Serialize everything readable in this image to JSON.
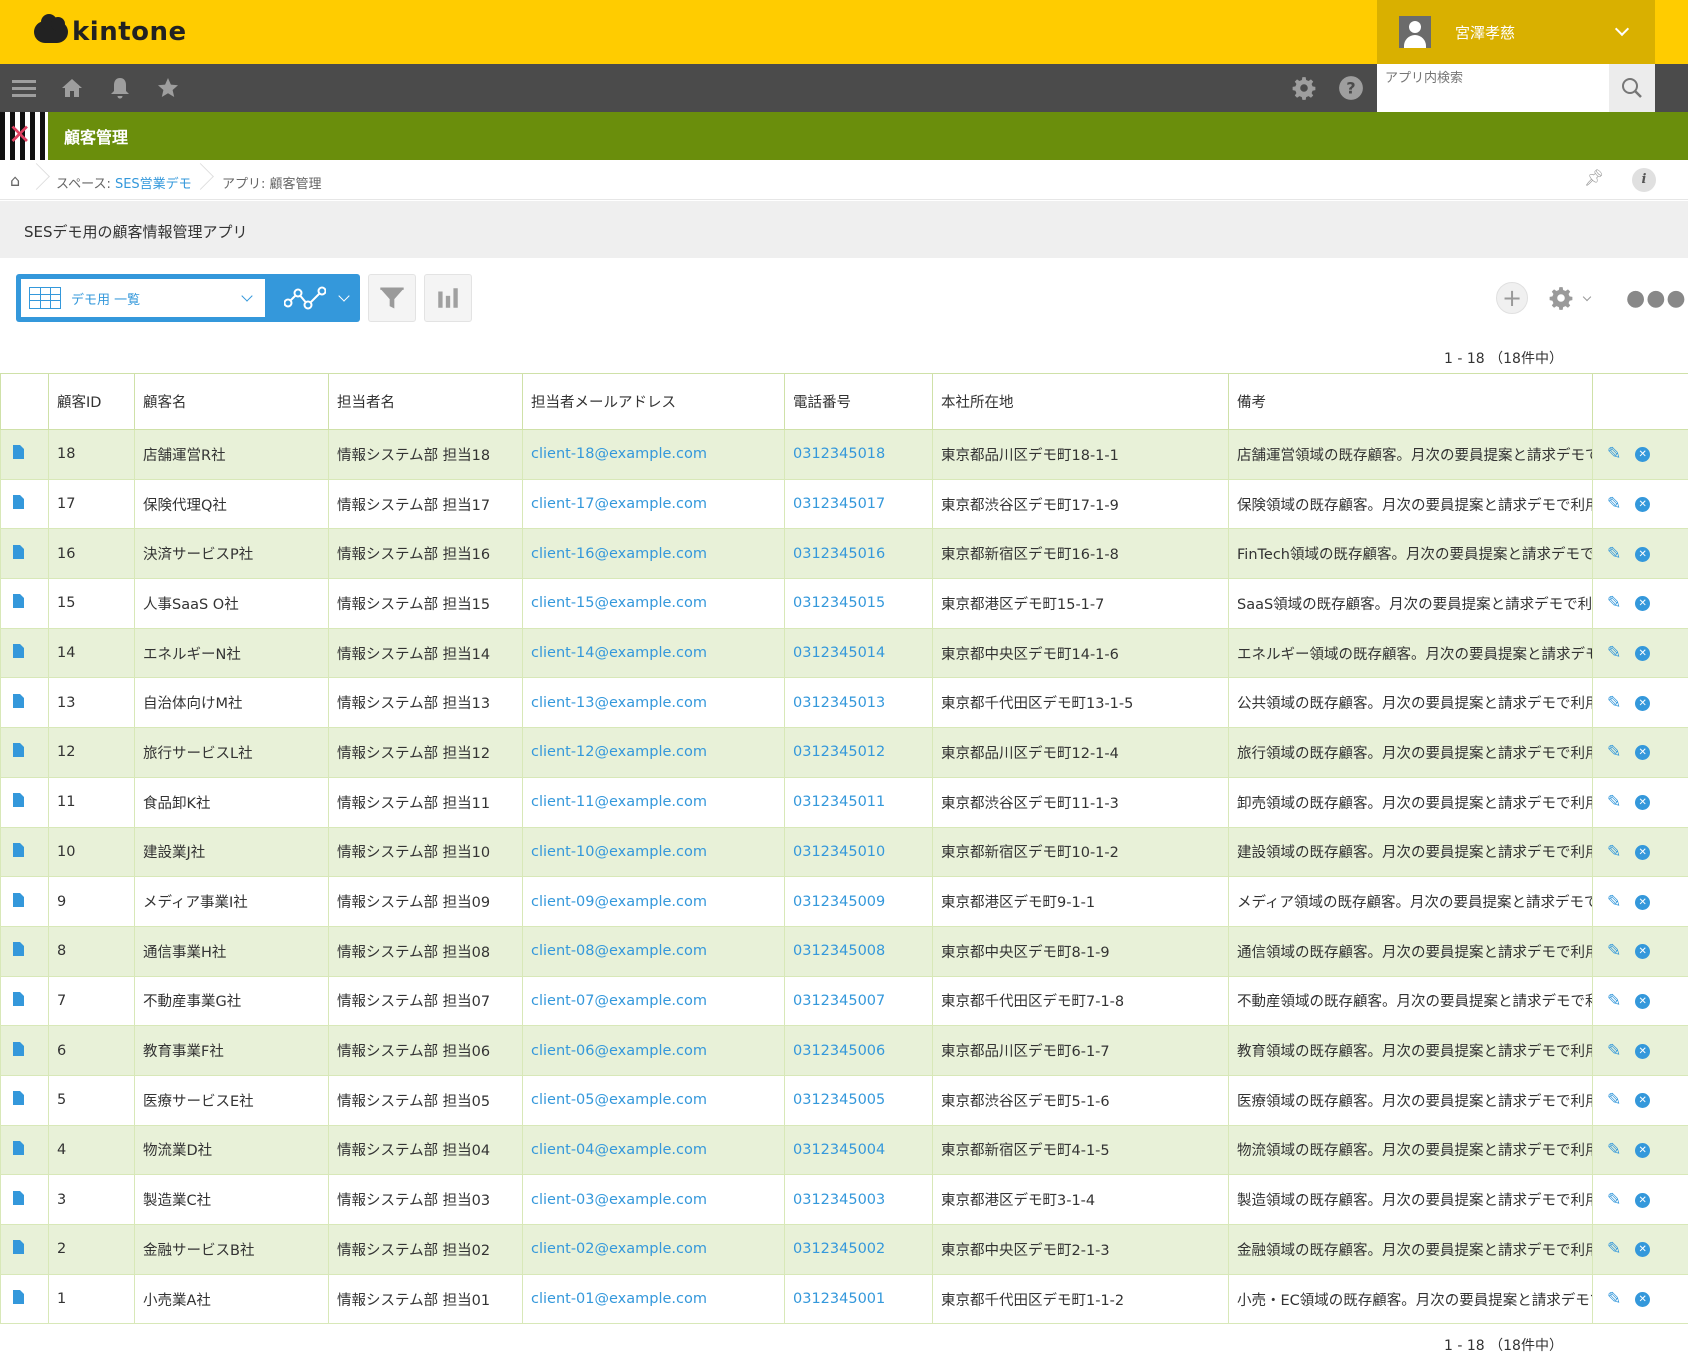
{
  "brand": {
    "logo_text": "kintone"
  },
  "user": {
    "name": "宮澤孝慈"
  },
  "search": {
    "placeholder": "アプリ内検索"
  },
  "app": {
    "name": "顧客管理"
  },
  "breadcrumb": {
    "space_prefix": "スペース: ",
    "space_name": "SES営業デモ",
    "app_label": "アプリ: 顧客管理"
  },
  "description": "SESデモ用の顧客情報管理アプリ",
  "view": {
    "name": "デモ用 一覧"
  },
  "count": {
    "top": "1 - 18 （18件中）",
    "bottom": "1 - 18 （18件中）"
  },
  "columns": [
    "顧客ID",
    "顧客名",
    "担当者名",
    "担当者メールアドレス",
    "電話番号",
    "本社所在地",
    "備考"
  ],
  "rows": [
    {
      "id": "18",
      "name": "店舗運営R社",
      "contact": "情報システム部 担当18",
      "email": "client-18@example.com",
      "phone": "0312345018",
      "address": "東京都品川区デモ町18-1-1",
      "note": "店舗運営領域の既存顧客。月次の要員提案と請求デモで"
    },
    {
      "id": "17",
      "name": "保険代理Q社",
      "contact": "情報システム部 担当17",
      "email": "client-17@example.com",
      "phone": "0312345017",
      "address": "東京都渋谷区デモ町17-1-9",
      "note": "保険領域の既存顧客。月次の要員提案と請求デモで利用"
    },
    {
      "id": "16",
      "name": "決済サービスP社",
      "contact": "情報システム部 担当16",
      "email": "client-16@example.com",
      "phone": "0312345016",
      "address": "東京都新宿区デモ町16-1-8",
      "note": "FinTech領域の既存顧客。月次の要員提案と請求デモで利"
    },
    {
      "id": "15",
      "name": "人事SaaS O社",
      "contact": "情報システム部 担当15",
      "email": "client-15@example.com",
      "phone": "0312345015",
      "address": "東京都港区デモ町15-1-7",
      "note": "SaaS領域の既存顧客。月次の要員提案と請求デモで利用"
    },
    {
      "id": "14",
      "name": "エネルギーN社",
      "contact": "情報システム部 担当14",
      "email": "client-14@example.com",
      "phone": "0312345014",
      "address": "東京都中央区デモ町14-1-6",
      "note": "エネルギー領域の既存顧客。月次の要員提案と請求デモ"
    },
    {
      "id": "13",
      "name": "自治体向けM社",
      "contact": "情報システム部 担当13",
      "email": "client-13@example.com",
      "phone": "0312345013",
      "address": "東京都千代田区デモ町13-1-5",
      "note": "公共領域の既存顧客。月次の要員提案と請求デモで利用"
    },
    {
      "id": "12",
      "name": "旅行サービスL社",
      "contact": "情報システム部 担当12",
      "email": "client-12@example.com",
      "phone": "0312345012",
      "address": "東京都品川区デモ町12-1-4",
      "note": "旅行領域の既存顧客。月次の要員提案と請求デモで利用"
    },
    {
      "id": "11",
      "name": "食品卸K社",
      "contact": "情報システム部 担当11",
      "email": "client-11@example.com",
      "phone": "0312345011",
      "address": "東京都渋谷区デモ町11-1-3",
      "note": "卸売領域の既存顧客。月次の要員提案と請求デモで利用"
    },
    {
      "id": "10",
      "name": "建設業J社",
      "contact": "情報システム部 担当10",
      "email": "client-10@example.com",
      "phone": "0312345010",
      "address": "東京都新宿区デモ町10-1-2",
      "note": "建設領域の既存顧客。月次の要員提案と請求デモで利用"
    },
    {
      "id": "9",
      "name": "メディア事業I社",
      "contact": "情報システム部 担当09",
      "email": "client-09@example.com",
      "phone": "0312345009",
      "address": "東京都港区デモ町9-1-1",
      "note": "メディア領域の既存顧客。月次の要員提案と請求デモで"
    },
    {
      "id": "8",
      "name": "通信事業H社",
      "contact": "情報システム部 担当08",
      "email": "client-08@example.com",
      "phone": "0312345008",
      "address": "東京都中央区デモ町8-1-9",
      "note": "通信領域の既存顧客。月次の要員提案と請求デモで利用"
    },
    {
      "id": "7",
      "name": "不動産事業G社",
      "contact": "情報システム部 担当07",
      "email": "client-07@example.com",
      "phone": "0312345007",
      "address": "東京都千代田区デモ町7-1-8",
      "note": "不動産領域の既存顧客。月次の要員提案と請求デモで利"
    },
    {
      "id": "6",
      "name": "教育事業F社",
      "contact": "情報システム部 担当06",
      "email": "client-06@example.com",
      "phone": "0312345006",
      "address": "東京都品川区デモ町6-1-7",
      "note": "教育領域の既存顧客。月次の要員提案と請求デモで利用"
    },
    {
      "id": "5",
      "name": "医療サービスE社",
      "contact": "情報システム部 担当05",
      "email": "client-05@example.com",
      "phone": "0312345005",
      "address": "東京都渋谷区デモ町5-1-6",
      "note": "医療領域の既存顧客。月次の要員提案と請求デモで利用"
    },
    {
      "id": "4",
      "name": "物流業D社",
      "contact": "情報システム部 担当04",
      "email": "client-04@example.com",
      "phone": "0312345004",
      "address": "東京都新宿区デモ町4-1-5",
      "note": "物流領域の既存顧客。月次の要員提案と請求デモで利用"
    },
    {
      "id": "3",
      "name": "製造業C社",
      "contact": "情報システム部 担当03",
      "email": "client-03@example.com",
      "phone": "0312345003",
      "address": "東京都港区デモ町3-1-4",
      "note": "製造領域の既存顧客。月次の要員提案と請求デモで利用"
    },
    {
      "id": "2",
      "name": "金融サービスB社",
      "contact": "情報システム部 担当02",
      "email": "client-02@example.com",
      "phone": "0312345002",
      "address": "東京都中央区デモ町2-1-3",
      "note": "金融領域の既存顧客。月次の要員提案と請求デモで利用"
    },
    {
      "id": "1",
      "name": "小売業A社",
      "contact": "情報システム部 担当01",
      "email": "client-01@example.com",
      "phone": "0312345001",
      "address": "東京都千代田区デモ町1-1-2",
      "note": "小売・EC領域の既存顧客。月次の要員提案と請求デモで"
    }
  ],
  "colors": {
    "header": "#ffcc00",
    "nav": "#4b4b4b",
    "appbar": "#6a8e0c",
    "accent": "#3498db",
    "row_alt": "#e8f1d8"
  },
  "icons": {
    "menu": "hamburger-icon",
    "home": "home-icon",
    "notify": "bell-icon",
    "favorite": "star-icon",
    "settings": "gear-icon",
    "help": "help-icon",
    "search": "search-icon",
    "record": "document-icon",
    "edit": "pencil-icon",
    "delete": "close-circle-icon"
  }
}
